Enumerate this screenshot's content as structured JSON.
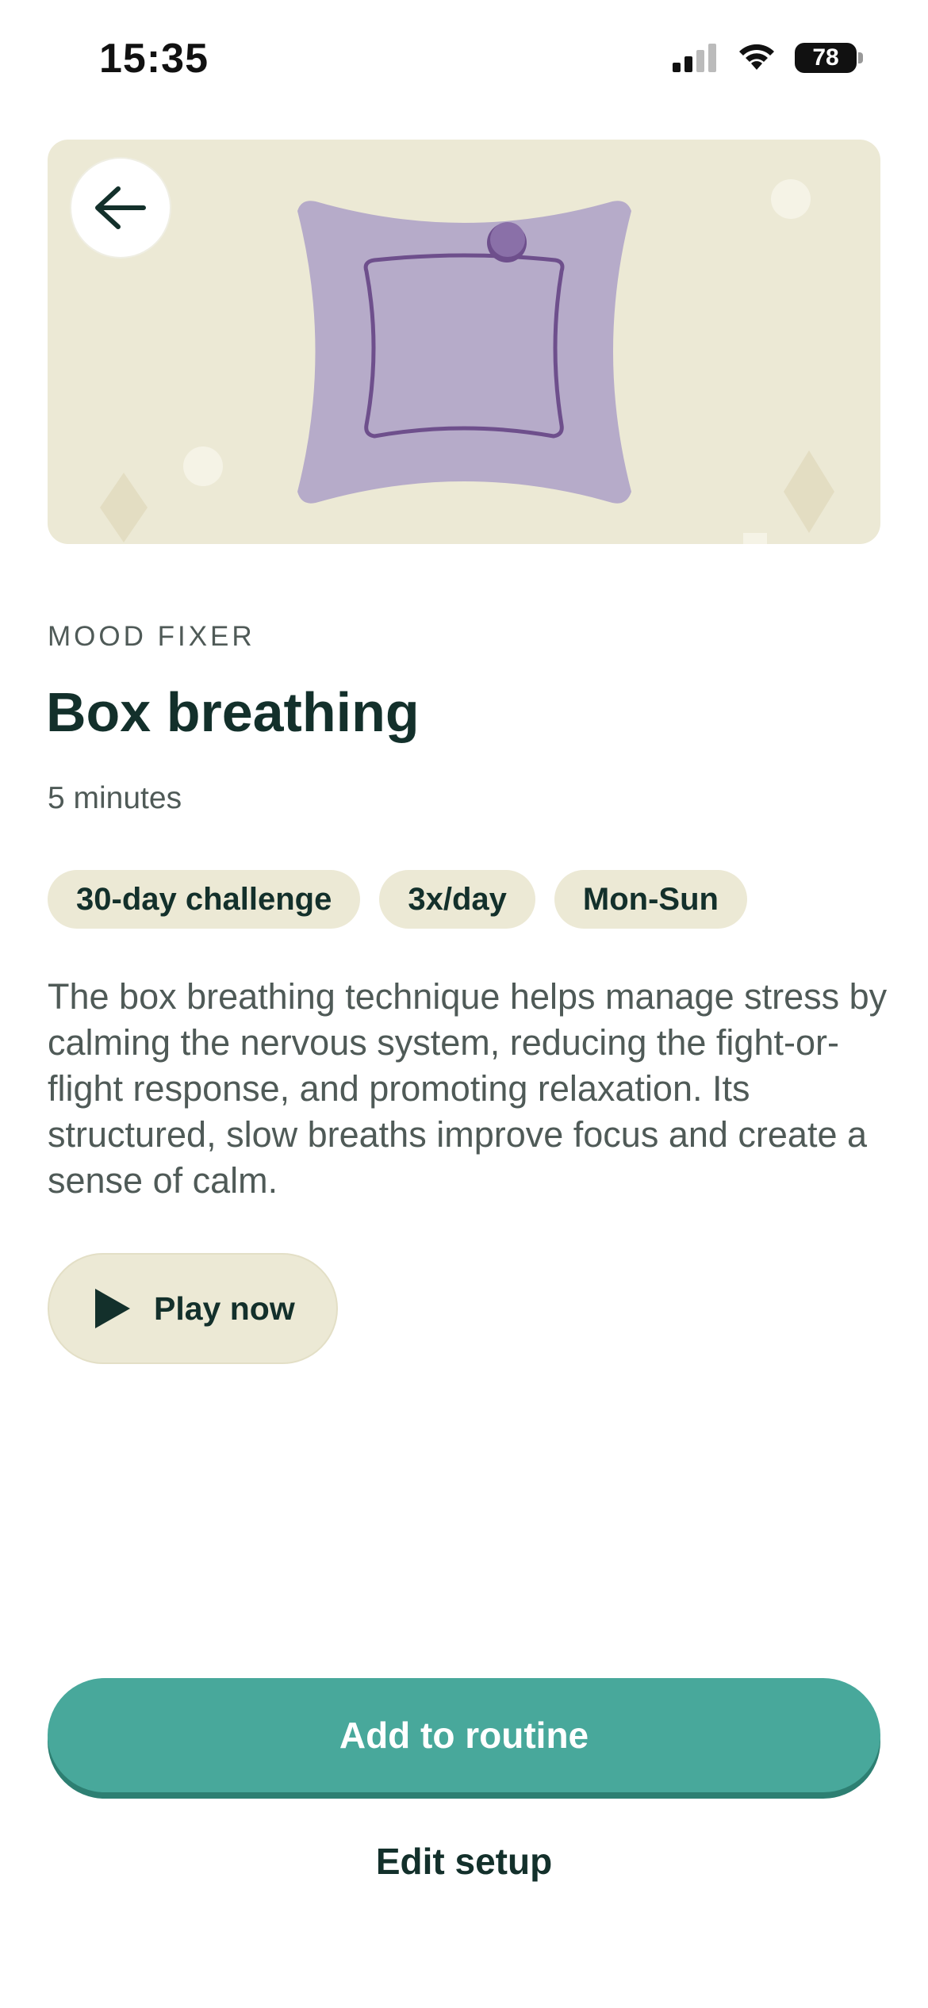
{
  "status_bar": {
    "time": "15:35",
    "battery": "78",
    "icons": [
      "cellular-signal-icon",
      "wifi-icon",
      "battery-icon"
    ]
  },
  "hero": {
    "back_icon": "arrow-left-icon",
    "illustration": "box-breathing-pillow-illustration",
    "colors": {
      "background": "#ece9d5",
      "pillow": "#b6abc9",
      "pillow_stroke": "#6e4f8c"
    }
  },
  "category": "MOOD FIXER",
  "title": "Box breathing",
  "duration": "5 minutes",
  "tags": [
    "30-day challenge",
    "3x/day",
    "Mon-Sun"
  ],
  "description": "The box breathing technique helps manage stress by calming the nervous system, reducing the fight-or-flight response, and promoting relaxation. Its structured, slow breaths improve focus and create a sense of calm.",
  "play_button": {
    "icon": "play-icon",
    "label": "Play now"
  },
  "actions": {
    "primary_label": "Add to routine",
    "secondary_label": "Edit setup"
  },
  "colors": {
    "accent": "#48a89b",
    "chip": "#ece9d5",
    "text": "#13302b"
  }
}
